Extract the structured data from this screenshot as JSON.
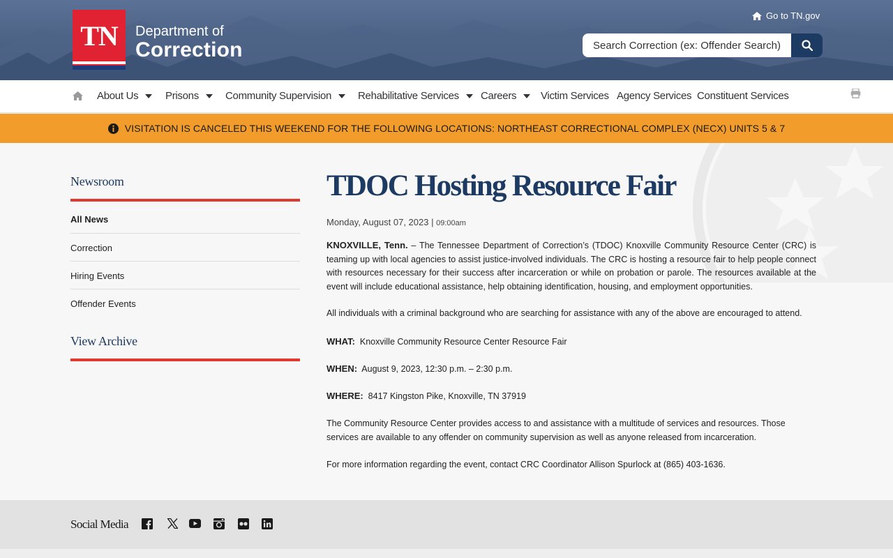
{
  "header": {
    "logo_badge": "TN",
    "logo_line1": "Department of",
    "logo_line2": "Correction",
    "goto_link": "Go to TN.gov",
    "search_placeholder": "Search Correction (ex: Offender Search)"
  },
  "nav": {
    "items": [
      {
        "label": "About Us",
        "dropdown": true
      },
      {
        "label": "Prisons",
        "dropdown": true
      },
      {
        "label": "Community Supervision",
        "dropdown": true
      },
      {
        "label": "Rehabilitative Services",
        "dropdown": true
      },
      {
        "label": "Careers",
        "dropdown": true
      },
      {
        "label": "Victim Services",
        "dropdown": false
      },
      {
        "label": "Agency Services",
        "dropdown": false
      },
      {
        "label": "Constituent Services",
        "dropdown": false
      }
    ]
  },
  "alert": {
    "text": "VISITATION IS CANCELED THIS WEEKEND FOR THE FOLLOWING LOCATIONS: NORTHEAST CORRECTIONAL COMPLEX (NECX) UNITS 5 & 7"
  },
  "sidebar": {
    "title": "Newsroom",
    "items": [
      "All News",
      "Correction",
      "Hiring Events",
      "Offender Events"
    ],
    "archive": "View Archive"
  },
  "article": {
    "title": "TDOC Hosting Resource Fair",
    "date": "Monday, August 07, 2023 | ",
    "time": "09:00am",
    "p1_lead": "KNOXVILLE, Tenn.",
    "p1_body": " – The Tennessee Department of Correction’s (TDOC) Knoxville Community Resource Center (CRC) is teaming up with local agencies to assist justice-involved individuals.  The CRC is hosting a resource fair to help people connect with resources necessary for their success after incarceration or while on probation or parole.  The resources available at the event will include educational assistance, help obtaining identification, housing, and employment opportunities.",
    "p2": "All individuals with a criminal background who are searching for assistance with any of the above are encouraged to attend.",
    "what_label": "WHAT:",
    "what_value": "  Knoxville Community Resource Center Resource Fair",
    "when_label": "WHEN:",
    "when_value": "  August 9, 2023, 12:30 p.m. – 2:30 p.m.",
    "where_label": "WHERE:",
    "where_value": "  8417 Kingston Pike, Knoxville, TN 37919",
    "p3": "The Community Resource Center provides access to and assistance with a multitude of services and resources.  Those services are available to any offender on community supervision as well as anyone released from incarceration.",
    "p4": "For more information regarding the event, contact CRC Coordinator Allison Spurlock at (865) 403-1636."
  },
  "footer": {
    "social_label": "Social Media",
    "icons": [
      "facebook-icon",
      "x-twitter-icon",
      "youtube-icon",
      "instagram-icon",
      "flickr-icon",
      "linkedin-icon"
    ]
  },
  "colors": {
    "header_bg": "#4a6082",
    "brand_red": "#e02232",
    "navy": "#1d3b62",
    "alert_orange": "#f29c2b",
    "accent_rule": "#e03a2f"
  }
}
